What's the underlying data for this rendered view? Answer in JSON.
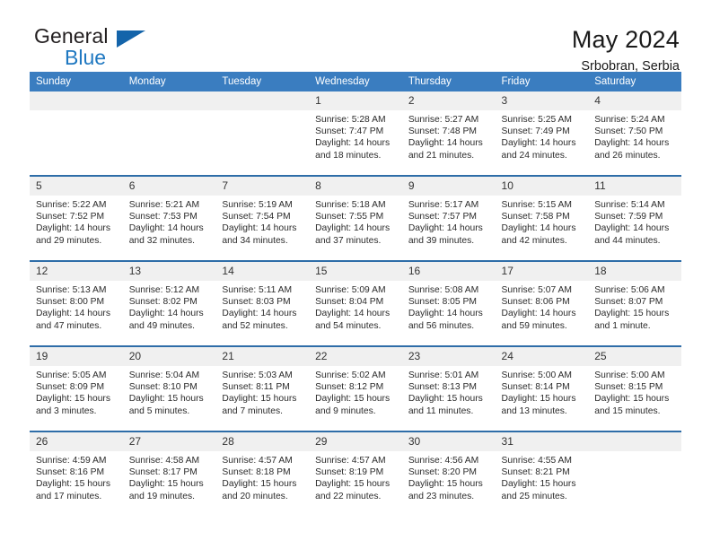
{
  "brand": {
    "name_part1": "General",
    "name_part2": "Blue",
    "flag_icon": "triangle-flag-icon"
  },
  "header": {
    "title": "May 2024",
    "location": "Srbobran, Serbia"
  },
  "calendar": {
    "weekday_headers": [
      "Sunday",
      "Monday",
      "Tuesday",
      "Wednesday",
      "Thursday",
      "Friday",
      "Saturday"
    ],
    "colors": {
      "header_blue": "#3a7dc0",
      "row_separator": "#2e6da8",
      "daynum_band": "#f0f0f0",
      "brand_blue": "#1f78c1"
    },
    "weeks": [
      [
        {
          "day": "",
          "empty": true
        },
        {
          "day": "",
          "empty": true
        },
        {
          "day": "",
          "empty": true
        },
        {
          "day": "1",
          "sunrise": "Sunrise: 5:28 AM",
          "sunset": "Sunset: 7:47 PM",
          "daylight": "Daylight: 14 hours and 18 minutes."
        },
        {
          "day": "2",
          "sunrise": "Sunrise: 5:27 AM",
          "sunset": "Sunset: 7:48 PM",
          "daylight": "Daylight: 14 hours and 21 minutes."
        },
        {
          "day": "3",
          "sunrise": "Sunrise: 5:25 AM",
          "sunset": "Sunset: 7:49 PM",
          "daylight": "Daylight: 14 hours and 24 minutes."
        },
        {
          "day": "4",
          "sunrise": "Sunrise: 5:24 AM",
          "sunset": "Sunset: 7:50 PM",
          "daylight": "Daylight: 14 hours and 26 minutes."
        }
      ],
      [
        {
          "day": "5",
          "sunrise": "Sunrise: 5:22 AM",
          "sunset": "Sunset: 7:52 PM",
          "daylight": "Daylight: 14 hours and 29 minutes."
        },
        {
          "day": "6",
          "sunrise": "Sunrise: 5:21 AM",
          "sunset": "Sunset: 7:53 PM",
          "daylight": "Daylight: 14 hours and 32 minutes."
        },
        {
          "day": "7",
          "sunrise": "Sunrise: 5:19 AM",
          "sunset": "Sunset: 7:54 PM",
          "daylight": "Daylight: 14 hours and 34 minutes."
        },
        {
          "day": "8",
          "sunrise": "Sunrise: 5:18 AM",
          "sunset": "Sunset: 7:55 PM",
          "daylight": "Daylight: 14 hours and 37 minutes."
        },
        {
          "day": "9",
          "sunrise": "Sunrise: 5:17 AM",
          "sunset": "Sunset: 7:57 PM",
          "daylight": "Daylight: 14 hours and 39 minutes."
        },
        {
          "day": "10",
          "sunrise": "Sunrise: 5:15 AM",
          "sunset": "Sunset: 7:58 PM",
          "daylight": "Daylight: 14 hours and 42 minutes."
        },
        {
          "day": "11",
          "sunrise": "Sunrise: 5:14 AM",
          "sunset": "Sunset: 7:59 PM",
          "daylight": "Daylight: 14 hours and 44 minutes."
        }
      ],
      [
        {
          "day": "12",
          "sunrise": "Sunrise: 5:13 AM",
          "sunset": "Sunset: 8:00 PM",
          "daylight": "Daylight: 14 hours and 47 minutes."
        },
        {
          "day": "13",
          "sunrise": "Sunrise: 5:12 AM",
          "sunset": "Sunset: 8:02 PM",
          "daylight": "Daylight: 14 hours and 49 minutes."
        },
        {
          "day": "14",
          "sunrise": "Sunrise: 5:11 AM",
          "sunset": "Sunset: 8:03 PM",
          "daylight": "Daylight: 14 hours and 52 minutes."
        },
        {
          "day": "15",
          "sunrise": "Sunrise: 5:09 AM",
          "sunset": "Sunset: 8:04 PM",
          "daylight": "Daylight: 14 hours and 54 minutes."
        },
        {
          "day": "16",
          "sunrise": "Sunrise: 5:08 AM",
          "sunset": "Sunset: 8:05 PM",
          "daylight": "Daylight: 14 hours and 56 minutes."
        },
        {
          "day": "17",
          "sunrise": "Sunrise: 5:07 AM",
          "sunset": "Sunset: 8:06 PM",
          "daylight": "Daylight: 14 hours and 59 minutes."
        },
        {
          "day": "18",
          "sunrise": "Sunrise: 5:06 AM",
          "sunset": "Sunset: 8:07 PM",
          "daylight": "Daylight: 15 hours and 1 minute."
        }
      ],
      [
        {
          "day": "19",
          "sunrise": "Sunrise: 5:05 AM",
          "sunset": "Sunset: 8:09 PM",
          "daylight": "Daylight: 15 hours and 3 minutes."
        },
        {
          "day": "20",
          "sunrise": "Sunrise: 5:04 AM",
          "sunset": "Sunset: 8:10 PM",
          "daylight": "Daylight: 15 hours and 5 minutes."
        },
        {
          "day": "21",
          "sunrise": "Sunrise: 5:03 AM",
          "sunset": "Sunset: 8:11 PM",
          "daylight": "Daylight: 15 hours and 7 minutes."
        },
        {
          "day": "22",
          "sunrise": "Sunrise: 5:02 AM",
          "sunset": "Sunset: 8:12 PM",
          "daylight": "Daylight: 15 hours and 9 minutes."
        },
        {
          "day": "23",
          "sunrise": "Sunrise: 5:01 AM",
          "sunset": "Sunset: 8:13 PM",
          "daylight": "Daylight: 15 hours and 11 minutes."
        },
        {
          "day": "24",
          "sunrise": "Sunrise: 5:00 AM",
          "sunset": "Sunset: 8:14 PM",
          "daylight": "Daylight: 15 hours and 13 minutes."
        },
        {
          "day": "25",
          "sunrise": "Sunrise: 5:00 AM",
          "sunset": "Sunset: 8:15 PM",
          "daylight": "Daylight: 15 hours and 15 minutes."
        }
      ],
      [
        {
          "day": "26",
          "sunrise": "Sunrise: 4:59 AM",
          "sunset": "Sunset: 8:16 PM",
          "daylight": "Daylight: 15 hours and 17 minutes."
        },
        {
          "day": "27",
          "sunrise": "Sunrise: 4:58 AM",
          "sunset": "Sunset: 8:17 PM",
          "daylight": "Daylight: 15 hours and 19 minutes."
        },
        {
          "day": "28",
          "sunrise": "Sunrise: 4:57 AM",
          "sunset": "Sunset: 8:18 PM",
          "daylight": "Daylight: 15 hours and 20 minutes."
        },
        {
          "day": "29",
          "sunrise": "Sunrise: 4:57 AM",
          "sunset": "Sunset: 8:19 PM",
          "daylight": "Daylight: 15 hours and 22 minutes."
        },
        {
          "day": "30",
          "sunrise": "Sunrise: 4:56 AM",
          "sunset": "Sunset: 8:20 PM",
          "daylight": "Daylight: 15 hours and 23 minutes."
        },
        {
          "day": "31",
          "sunrise": "Sunrise: 4:55 AM",
          "sunset": "Sunset: 8:21 PM",
          "daylight": "Daylight: 15 hours and 25 minutes."
        },
        {
          "day": "",
          "empty": true
        }
      ]
    ]
  }
}
